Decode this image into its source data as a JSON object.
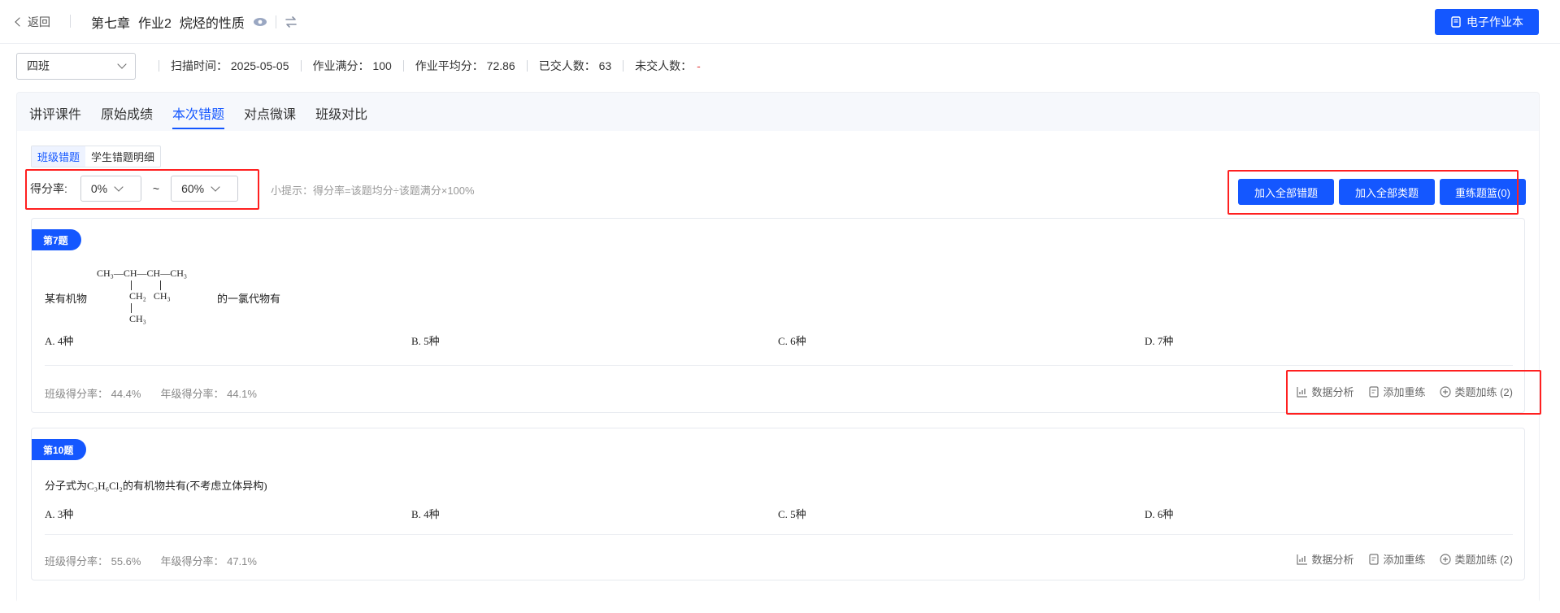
{
  "header": {
    "back_label": "返回",
    "chapter": "第七章",
    "assignment": "作业2",
    "topic": "烷烃的性质",
    "ebook_label": "电子作业本"
  },
  "infobar": {
    "class_selected": "四班",
    "scan_time": "扫描时间： 2025-05-05",
    "full_score": "作业满分： 100",
    "avg_score": "作业平均分： 72.86",
    "submitted": "已交人数： 63",
    "not_submitted_label": "未交人数：",
    "not_submitted_value": "-"
  },
  "tabs": [
    {
      "label": "讲评课件"
    },
    {
      "label": "原始成绩"
    },
    {
      "label": "本次错题"
    },
    {
      "label": "对点微课"
    },
    {
      "label": "班级对比"
    }
  ],
  "subtabs": [
    {
      "label": "班级错题"
    },
    {
      "label": "学生错题明细"
    }
  ],
  "filter": {
    "label": "得分率:",
    "min": "0%",
    "tilde": "~",
    "max": "60%",
    "hint": "小提示：得分率=该题均分÷该题满分×100%"
  },
  "buttons": {
    "add_all_wrong": "加入全部错题",
    "add_all_similar": "加入全部类题",
    "retrain_basket": "重练题篮(0)"
  },
  "questions": [
    {
      "badge": "第7题",
      "stem_prefix": "某有机物",
      "stem_suffix": "的一氯代物有",
      "structure": {
        "row1": "CH₃—CH—CH—CH₃",
        "row2": "CH₂   CH₃",
        "row3": "CH₃"
      },
      "options": [
        "A. 4种",
        "B. 5种",
        "C. 6种",
        "D. 7种"
      ],
      "class_rate": "班级得分率： 44.4%",
      "grade_rate": "年级得分率： 44.1%",
      "actions": {
        "analysis": "数据分析",
        "add_retrain": "添加重练",
        "similar": "类题加练 (2)"
      }
    },
    {
      "badge": "第10题",
      "stem_text": "分子式为C₃H₆Cl₂的有机物共有(不考虑立体异构)",
      "options": [
        "A. 3种",
        "B. 4种",
        "C. 5种",
        "D. 6种"
      ],
      "class_rate": "班级得分率： 55.6%",
      "grade_rate": "年级得分率： 47.1%",
      "actions": {
        "analysis": "数据分析",
        "add_retrain": "添加重练",
        "similar": "类题加练 (2)"
      }
    }
  ],
  "colors": {
    "primary": "#1457ff",
    "highlight_box": "#ff2020",
    "danger": "#e23c3c"
  }
}
